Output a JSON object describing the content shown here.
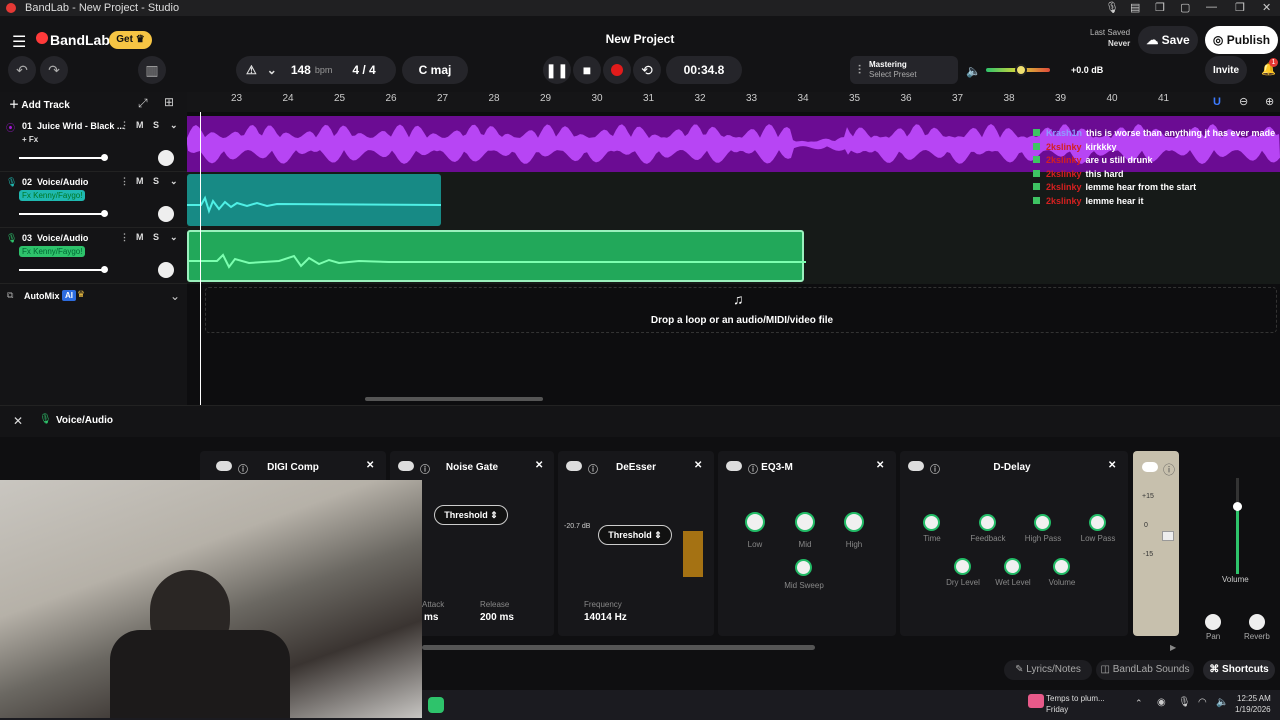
{
  "window": {
    "title": "BandLab - New Project - Studio"
  },
  "header": {
    "logo": "BandLab",
    "get_label": "Get",
    "project_title": "New Project",
    "last_saved_label": "Last Saved",
    "last_saved_value": "Never",
    "save_label": "Save",
    "publish_label": "Publish",
    "invite_label": "Invite",
    "notification_count": "1",
    "tempo": "148",
    "tempo_unit": "bpm",
    "time_signature": "4 / 4",
    "key": "C maj",
    "time": "00:34.8",
    "mastering_label": "Mastering",
    "mastering_preset": "Select Preset",
    "volume_db": "+0.0 dB",
    "volume_level": 0.55
  },
  "tracks_header": {
    "add_track_label": "Add Track"
  },
  "ruler": {
    "bars": [
      "23",
      "24",
      "25",
      "26",
      "27",
      "28",
      "29",
      "30",
      "31",
      "32",
      "33",
      "34",
      "35",
      "36",
      "37",
      "38",
      "39",
      "40",
      "41"
    ]
  },
  "tracks": [
    {
      "number": "01",
      "name": "Juice Wrld - Black ...",
      "fx": "+ Fx",
      "color": "#a319d6",
      "volume": 0.95
    },
    {
      "number": "02",
      "name": "Voice/Audio",
      "fx": "Fx Kenny/Faygo!",
      "color": "#1fb8b0",
      "volume": 0.95
    },
    {
      "number": "03",
      "name": "Voice/Audio",
      "fx": "Fx Kenny/Faygo!",
      "color": "#2ec36b",
      "volume": 0.95
    }
  ],
  "mute_label": "M",
  "solo_label": "S",
  "automix": {
    "label": "AutoMix",
    "badge": "AI"
  },
  "drop_zone": {
    "text": "Drop a loop or an audio/MIDI/video file"
  },
  "chat": [
    {
      "user": "Krash1n",
      "msg": "this is worse than anything jt has ever made",
      "color": "#8f9bff"
    },
    {
      "user": "2kslinky",
      "msg": "kirkkky",
      "color": "#d42020"
    },
    {
      "user": "2kslinky",
      "msg": "are u still drunk",
      "color": "#d42020"
    },
    {
      "user": "2kslinky",
      "msg": "this hard",
      "color": "#d42020"
    },
    {
      "user": "2kslinky",
      "msg": "lemme hear from the start",
      "color": "#d42020"
    },
    {
      "user": "2kslinky",
      "msg": "lemme hear it",
      "color": "#d42020"
    }
  ],
  "bottom_panel": {
    "track_label": "Voice/Audio"
  },
  "plugins": [
    {
      "name": "DIGI Comp"
    },
    {
      "name": "Noise Gate",
      "threshold": "Threshold",
      "attack_label": "Attack",
      "attack_value": "ms",
      "release_label": "Release",
      "release_value": "200 ms"
    },
    {
      "name": "DeEsser",
      "threshold": "Threshold",
      "level": "-20.7 dB",
      "freq_label": "Frequency",
      "freq_value": "14014 Hz"
    },
    {
      "name": "EQ3-M",
      "knobs": [
        "Low",
        "Mid",
        "High",
        "Mid Sweep"
      ]
    },
    {
      "name": "D-Delay",
      "knobs": [
        "Time",
        "Feedback",
        "High Pass",
        "Low Pass",
        "Dry Level",
        "Wet Level",
        "Volume"
      ]
    }
  ],
  "mixer": {
    "scale": [
      "+15",
      "0",
      "-15"
    ],
    "volume_label": "Volume",
    "pan_label": "Pan",
    "reverb_label": "Reverb"
  },
  "footer_tabs": {
    "lyrics": "Lyrics/Notes",
    "sounds": "BandLab Sounds",
    "shortcuts": "Shortcuts"
  },
  "taskbar": {
    "weather_line1": "Temps to plum...",
    "weather_line2": "Friday",
    "time": "12:25 AM",
    "date": "1/19/2026"
  }
}
